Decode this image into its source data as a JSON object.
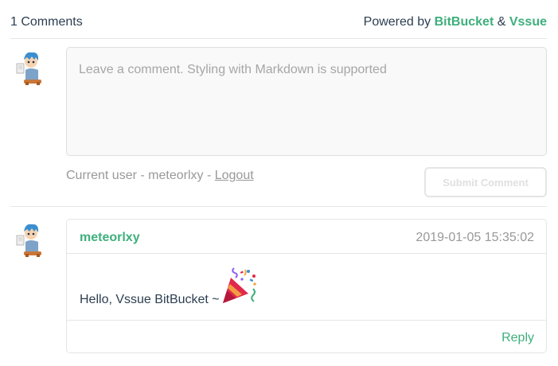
{
  "header": {
    "comment_count": "1 Comments",
    "powered_prefix": "Powered by",
    "platform_link": "BitBucket",
    "ampersand": "&",
    "vssue_link": "Vssue"
  },
  "editor": {
    "placeholder": "Leave a comment. Styling with Markdown is supported",
    "value": "",
    "avatar_icon": "user-avatar-icon"
  },
  "status": {
    "current_user_text": "Current user - meteorlxy -",
    "logout_label": "Logout"
  },
  "submit_button": {
    "label": "Submit Comment",
    "disabled": true
  },
  "comments": [
    {
      "author": "meteorlxy",
      "time": "2019-01-05 15:35:02",
      "content": "Hello, Vssue BitBucket ~",
      "emoji": "party-popper-icon",
      "reply_label": "Reply"
    }
  ],
  "colors": {
    "accent": "#3eaf7c",
    "text": "#2c3e50",
    "muted": "#999999",
    "border": "#e6e6e6"
  }
}
